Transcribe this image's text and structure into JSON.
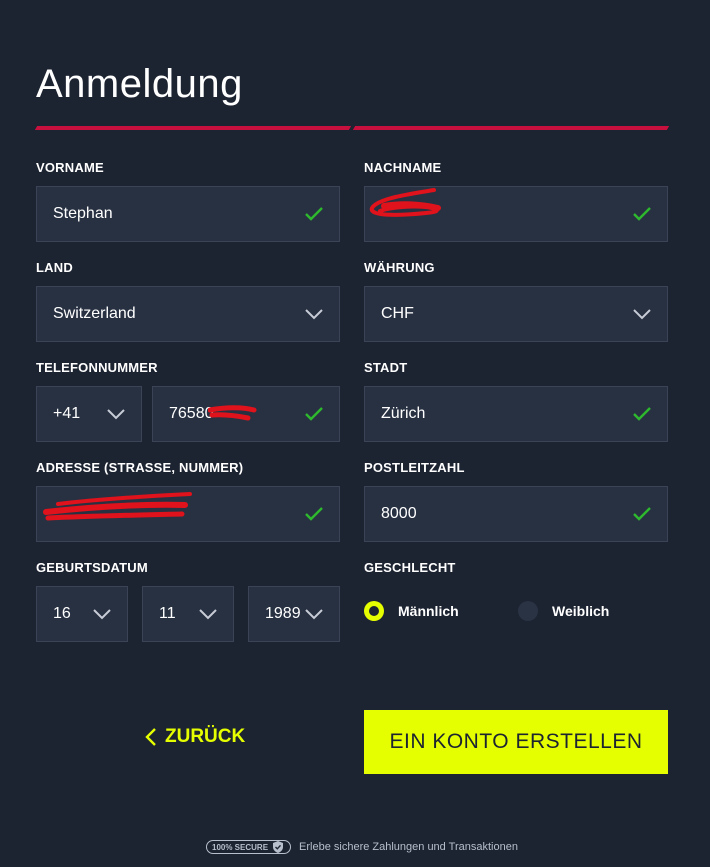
{
  "page": {
    "title": "Anmeldung"
  },
  "fields": {
    "vorname": {
      "label": "VORNAME",
      "value": "Stephan"
    },
    "nachname": {
      "label": "NACHNAME",
      "value": ""
    },
    "land": {
      "label": "LAND",
      "value": "Switzerland"
    },
    "waehrung": {
      "label": "WÄHRUNG",
      "value": "CHF"
    },
    "telefon": {
      "label": "TELEFONNUMMER",
      "prefix": "+41",
      "value": "76580"
    },
    "stadt": {
      "label": "STADT",
      "value": "Zürich"
    },
    "adresse": {
      "label": "ADRESSE (STRASSE, NUMMER)",
      "value": ""
    },
    "plz": {
      "label": "POSTLEITZAHL",
      "value": "8000"
    },
    "geburtsdatum": {
      "label": "GEBURTSDATUM",
      "day": "16",
      "month": "11",
      "year": "1989"
    },
    "geschlecht": {
      "label": "GESCHLECHT",
      "options": [
        "Männlich",
        "Weiblich"
      ],
      "selected": "Männlich"
    }
  },
  "actions": {
    "back_label": "ZURÜCK",
    "submit_label": "EIN KONTO ERSTELLEN"
  },
  "footer": {
    "badge": "100% SECURE",
    "text": "Erlebe sichere Zahlungen und Transaktionen"
  },
  "colors": {
    "background": "#1c2331",
    "field": "#283142",
    "accent": "#e6ff00",
    "progress": "#c8103e",
    "valid": "#2eb82e",
    "redaction": "#e0121b"
  }
}
